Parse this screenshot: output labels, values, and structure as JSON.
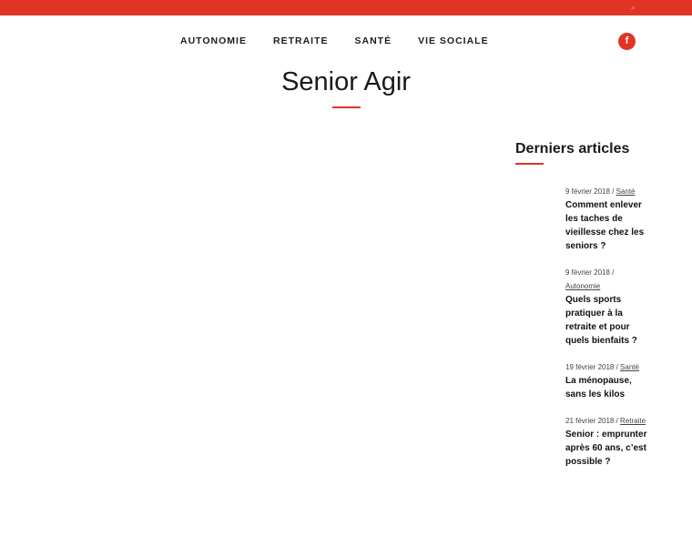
{
  "nav": {
    "items": [
      "AUTONOMIE",
      "RETRAITE",
      "SANTÉ",
      "VIE SOCIALE"
    ],
    "facebook_icon": "f"
  },
  "site": {
    "title": "Senior Agir"
  },
  "sidebar": {
    "heading": "Derniers articles",
    "articles": [
      {
        "date": "9 février 2018",
        "category": "Santé",
        "title": "Comment enlever les taches de vieillesse chez les seniors ?"
      },
      {
        "date": "9 février 2018",
        "category": "Autonomie",
        "title": "Quels sports pratiquer à la retraite et pour quels bienfaits ?"
      },
      {
        "date": "19 février 2018",
        "category": "Santé",
        "title": "La ménopause, sans les kilos"
      },
      {
        "date": "21 février 2018",
        "category": "Retraite",
        "title": "Senior : emprunter après 60 ans, c’est possible ?"
      }
    ]
  },
  "colors": {
    "accent": "#e03424"
  }
}
